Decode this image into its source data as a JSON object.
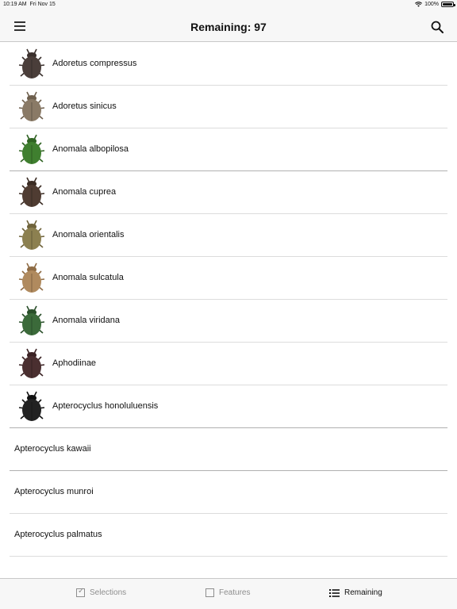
{
  "status_bar": {
    "time": "10:19 AM",
    "date": "Fri Nov 15",
    "battery": "100%"
  },
  "nav": {
    "title": "Remaining: 97",
    "menu_icon": "hamburger-menu-icon",
    "search_icon": "search-icon"
  },
  "species": [
    {
      "name": "Adoretus compressus",
      "thumb": {
        "body": "#4a3e3a",
        "head": "#3a302d"
      }
    },
    {
      "name": "Adoretus sinicus",
      "thumb": {
        "body": "#8a7a66",
        "head": "#6e5f4d"
      }
    },
    {
      "name": "Anomala albopilosa",
      "thumb": {
        "body": "#3f7f2f",
        "head": "#2f6322"
      }
    },
    {
      "name": "Anomala cuprea",
      "thumb": {
        "body": "#4f3c32",
        "head": "#3b2c24"
      }
    },
    {
      "name": "Anomala orientalis",
      "thumb": {
        "body": "#8c8050",
        "head": "#6f633b"
      }
    },
    {
      "name": "Anomala sulcatula",
      "thumb": {
        "body": "#b08a5e",
        "head": "#8f6c45"
      }
    },
    {
      "name": "Anomala viridana",
      "thumb": {
        "body": "#3b6a3a",
        "head": "#2a4f2a"
      }
    },
    {
      "name": "Aphodiinae",
      "thumb": {
        "body": "#4a2f30",
        "head": "#3a2224"
      }
    },
    {
      "name": "Apterocyclus honoluluensis",
      "thumb": {
        "body": "#222222",
        "head": "#111111"
      }
    },
    {
      "name": "Apterocyclus kawaii"
    },
    {
      "name": "Apterocyclus munroi"
    },
    {
      "name": "Apterocyclus palmatus"
    },
    {
      "name": ""
    }
  ],
  "tabs": [
    {
      "label": "Selections",
      "icon": "checkbox-checked-icon",
      "active": false
    },
    {
      "label": "Features",
      "icon": "checkbox-empty-icon",
      "active": false
    },
    {
      "label": "Remaining",
      "icon": "list-icon",
      "active": true
    }
  ]
}
